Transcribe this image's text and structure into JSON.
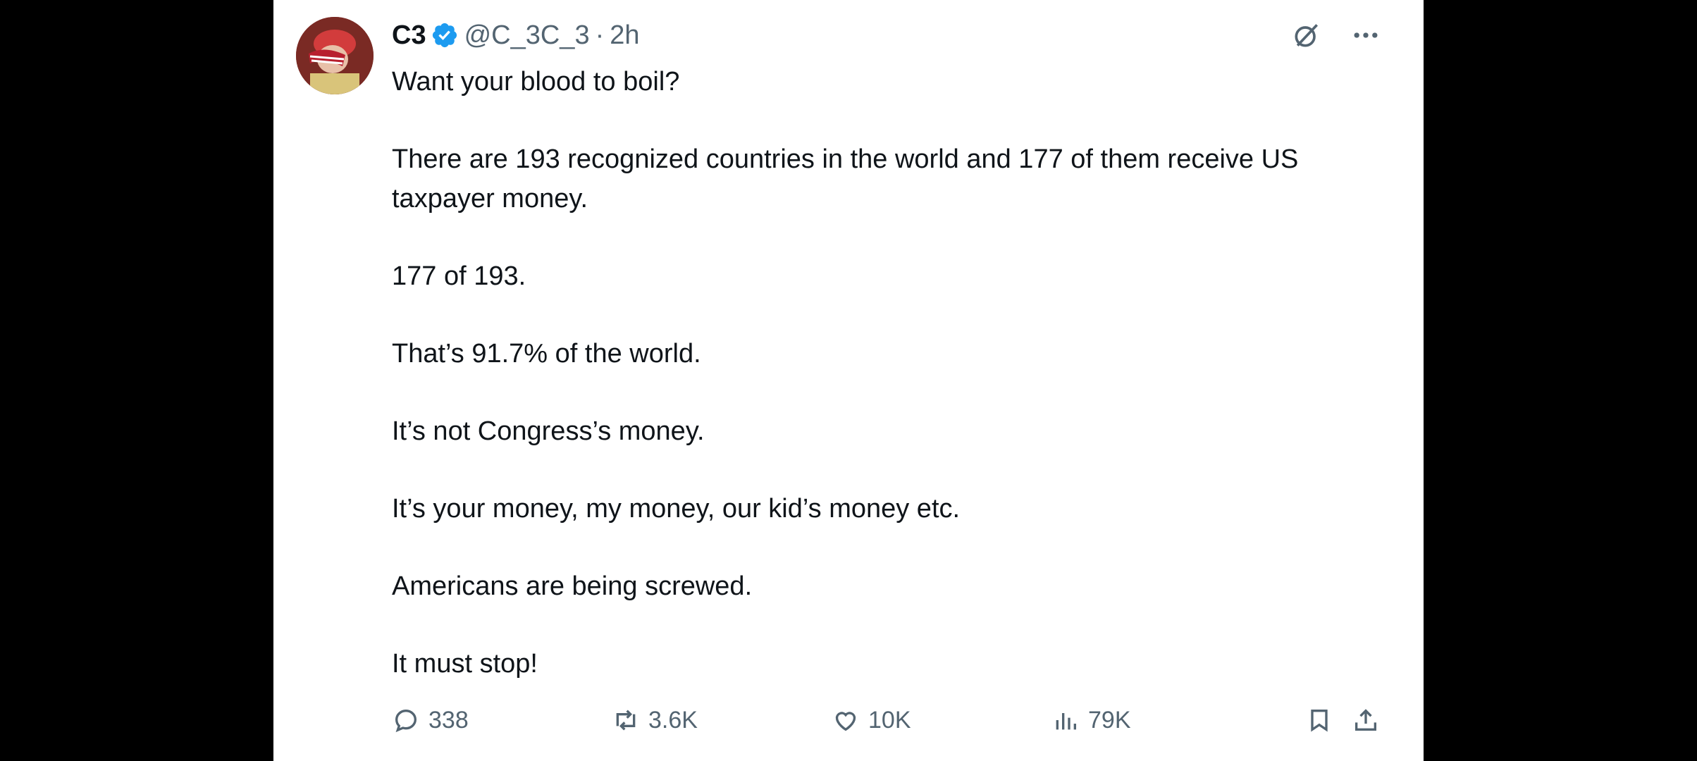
{
  "tweet": {
    "display_name": "C3",
    "handle": "@C_3C_3",
    "separator": "·",
    "time": "2h",
    "paragraphs": [
      "Want your blood to boil?",
      "There are 193 recognized countries in the world and 177 of them receive US taxpayer money.",
      "177 of 193.",
      "That’s 91.7% of the world.",
      "It’s not Congress’s money.",
      "It’s your money, my money, our kid’s money etc.",
      "Americans are being screwed.",
      "It must stop!"
    ]
  },
  "icons": {
    "verified": "verified-badge-icon",
    "grok": "grok-icon",
    "more": "more-icon",
    "reply": "reply-icon",
    "retweet": "retweet-icon",
    "like": "like-icon",
    "views": "views-icon",
    "bookmark": "bookmark-icon",
    "share": "share-icon"
  },
  "metrics": {
    "replies": "338",
    "retweets": "3.6K",
    "likes": "10K",
    "views": "79K"
  },
  "colors": {
    "background": "#000000",
    "card": "#ffffff",
    "text": "#0f1419",
    "secondary": "#536471",
    "verified": "#1d9bf0"
  }
}
